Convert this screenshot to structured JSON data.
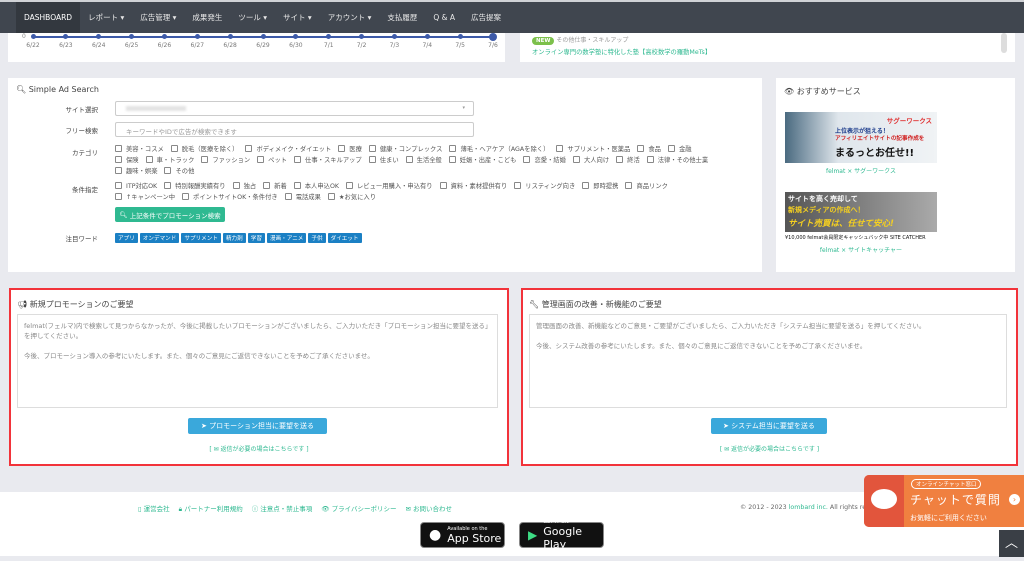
{
  "nav": {
    "items": [
      {
        "label": "DASHBOARD",
        "active": true
      },
      {
        "label": "レポート ▾"
      },
      {
        "label": "広告管理 ▾"
      },
      {
        "label": "成果発生"
      },
      {
        "label": "ツール ▾"
      },
      {
        "label": "サイト ▾"
      },
      {
        "label": "アカウント ▾"
      },
      {
        "label": "支払履歴"
      },
      {
        "label": "Q & A"
      },
      {
        "label": "広告提案"
      }
    ]
  },
  "timeline": {
    "y_tick": "0",
    "dates": [
      "6/22",
      "6/23",
      "6/24",
      "6/25",
      "6/26",
      "6/27",
      "6/28",
      "6/29",
      "6/30",
      "7/1",
      "7/2",
      "7/3",
      "7/4",
      "7/5",
      "7/6"
    ]
  },
  "news": {
    "badge": "NEW",
    "category": "その他仕事・スキルアップ",
    "title": "オンライン専門の数学塾に特化した塾【高校数学の羅動MeTs】"
  },
  "search": {
    "title": "Simple Ad Search",
    "site_label": "サイト選択",
    "free_label": "フリー検索",
    "free_placeholder": "キーワードやIDで広告が検索できます",
    "category_label": "カテゴリ",
    "categories": [
      "美容・コスメ",
      "脱毛（医療を除く）",
      "ボディメイク・ダイエット",
      "医療",
      "健康・コンプレックス",
      "薄毛・ヘアケア（AGAを除く）",
      "サプリメント・医薬品",
      "食品",
      "金融",
      "保険",
      "車・トラック",
      "ファッション",
      "ペット",
      "仕事・スキルアップ",
      "住まい",
      "生活全般",
      "妊娠・出産・こども",
      "恋愛・結婚",
      "大人向け",
      "終活",
      "法律・その他士業",
      "趣味・娯楽",
      "その他"
    ],
    "condition_label": "条件指定",
    "conditions": [
      "ITP対応OK",
      "特別報酬実績有り",
      "独占",
      "新着",
      "本人申込OK",
      "レビュー用購入・申込有り",
      "資料・素材提供有り",
      "リスティング向き",
      "即時提携",
      "商品リンク",
      "↑キャンペーン中",
      "ポイントサイトOK・条件付き",
      "電話成果",
      "★お気に入り"
    ],
    "search_button": "上記条件でプロモーション検索",
    "tag_label": "注目ワード",
    "tags": [
      "アプリ",
      "オンデマンド",
      "サプリメント",
      "精力剤",
      "学習",
      "漫画・アニメ",
      "子供",
      "ダイエット"
    ]
  },
  "recommend": {
    "title": "おすすめサービス",
    "items": [
      {
        "banner_top": "サグーワークス",
        "banner_l1": "上位表示が狙える！",
        "banner_l2": "アフィリエイトサイトの記事作成を",
        "banner_l3": "まるっとお任せ!!",
        "caption": "felmat × サグーワークス"
      },
      {
        "banner_l1": "サイトを高く売却して",
        "banner_l2": "新規メディアの作成へ！",
        "banner_l3": "サイト売買は、任せて安心!",
        "banner_bottom": "¥10,000 felmat会員限定キャッシュバック中 SITE CATCHER",
        "caption": "felmat × サイトキャッチャー"
      }
    ]
  },
  "req_promo": {
    "title": "新規プロモーションのご要望",
    "p1": "felmat(フェルマ)内で検索して見つからなかったが、今後に掲載したいプロモーションがございましたら、ご入力いただき「プロモーション担当に要望を送る」を押してください。",
    "p2": "今後、プロモーション導入の参考にいたします。また、個々のご意見にご返信できないことを予めご了承くださいませ。",
    "button": "プロモーション担当に要望を送る",
    "link": "[ ✉ 返信が必要の場合はこちらです ]"
  },
  "req_system": {
    "title": "管理画面の改善・新機能のご要望",
    "p1": "管理画面の改善、新機能などのご意見・ご要望がございましたら、ご入力いただき「システム担当に要望を送る」を押してください。",
    "p2": "今後、システム改善の参考にいたします。また、個々のご意見にご返信できないことを予めご了承くださいませ。",
    "button": "システム担当に要望を送る",
    "link": "[ ✉ 返信が必要の場合はこちらです ]"
  },
  "footer": {
    "links": [
      "運営会社",
      "パートナー利用規約",
      "注意点・禁止事項",
      "プライバシーポリシー",
      "お問い合わせ"
    ],
    "copyright": "© 2012 - 2023 ",
    "company": "lombard inc.",
    "rights": " All rights reserved.",
    "appstore_small": "Available on the",
    "appstore": "App Store",
    "gplay_small": "GET IT ON",
    "gplay": "Google Play"
  },
  "chat": {
    "badge": "オンラインチャット窓口",
    "title": "チャットで質問",
    "sub": "お気軽にご利用ください"
  },
  "colors": {
    "nav": "#40464f",
    "accent": "#2fb991",
    "button_blue": "#3aa8db",
    "highlight": "#f2333a",
    "chat": "#f08040"
  }
}
